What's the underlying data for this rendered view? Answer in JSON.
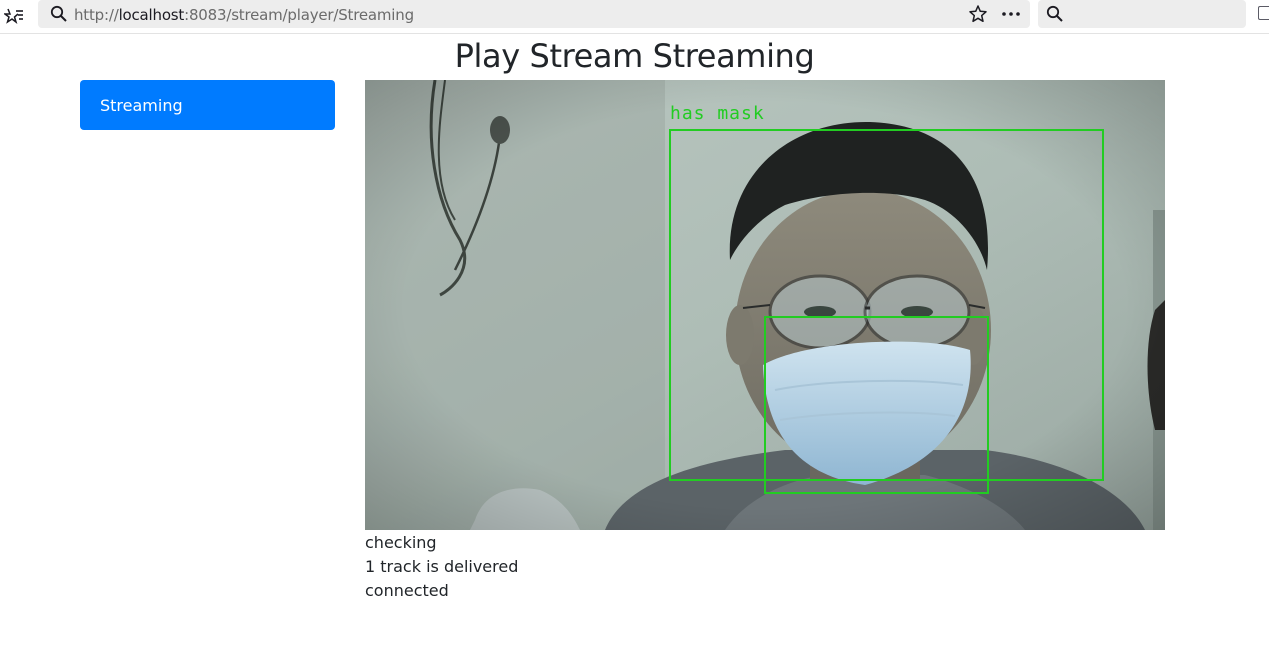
{
  "browser": {
    "url_prefix": "http://",
    "url_host": "localhost",
    "url_rest": ":8083/stream/player/Streaming"
  },
  "page": {
    "title": "Play Stream Streaming"
  },
  "sidebar": {
    "items": [
      {
        "label": "Streaming",
        "active": true
      }
    ]
  },
  "video": {
    "detection_label": "has mask",
    "box_color": "#22cc22"
  },
  "status": {
    "lines": [
      "checking",
      "1 track is delivered",
      "connected"
    ]
  },
  "colors": {
    "accent": "#007bff"
  }
}
